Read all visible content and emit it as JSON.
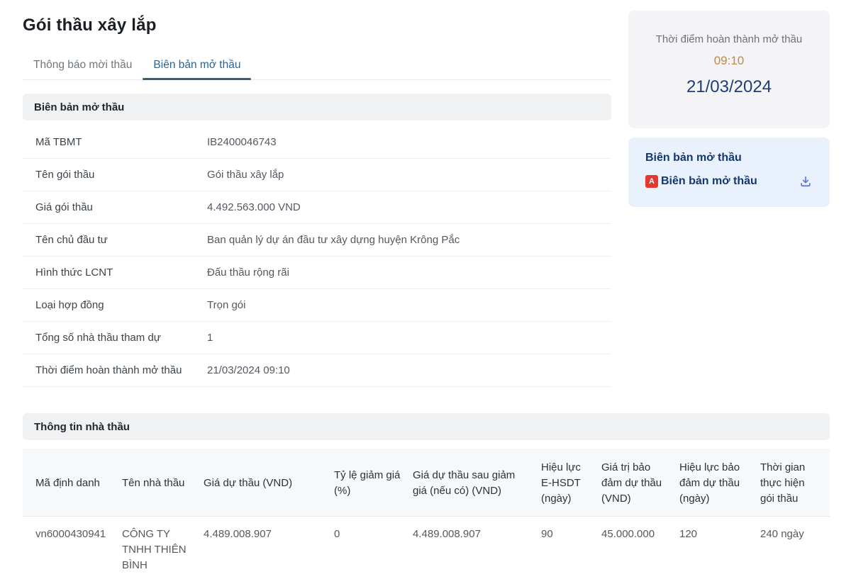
{
  "page": {
    "title": "Gói thầu xây lắp"
  },
  "tabs": [
    {
      "label": "Thông báo mời thầu",
      "active": false
    },
    {
      "label": "Biên bản mở thầu",
      "active": true
    }
  ],
  "sections": {
    "open_record": "Biên bản mở thầu",
    "contractor_info": "Thông tin nhà thầu"
  },
  "details": [
    {
      "label": "Mã TBMT",
      "value": "IB2400046743"
    },
    {
      "label": "Tên gói thầu",
      "value": "Gói thầu xây lắp"
    },
    {
      "label": "Giá gói thầu",
      "value": "4.492.563.000 VND"
    },
    {
      "label": "Tên chủ đầu tư",
      "value": "Ban quản lý dự án đầu tư xây dựng huyện Krông Pắc"
    },
    {
      "label": "Hình thức LCNT",
      "value": "Đấu thầu rộng rãi"
    },
    {
      "label": "Loại hợp đồng",
      "value": "Trọn gói"
    },
    {
      "label": "Tổng số nhà thầu tham dự",
      "value": "1"
    },
    {
      "label": "Thời điểm hoàn thành mở thầu",
      "value": "21/03/2024 09:10"
    }
  ],
  "sidebar": {
    "completion": {
      "label": "Thời điểm hoàn thành mở thầu",
      "time": "09:10",
      "date": "21/03/2024"
    },
    "record": {
      "title": "Biên bản mở thầu",
      "file_label": "Biên bản mở thầu",
      "pdf_icon": "pdf-file-icon",
      "download_icon": "download-icon"
    }
  },
  "table": {
    "columns": [
      "Mã định danh",
      "Tên nhà thầu",
      "Giá dự thầu (VND)",
      "Tỷ lệ giảm giá (%)",
      "Giá dự thầu sau giảm giá (nếu có) (VND)",
      "Hiệu lực E-HSDT (ngày)",
      "Giá trị bảo đảm dự thầu (VND)",
      "Hiệu lực bảo đảm dự thầu (ngày)",
      "Thời gian thực hiện gói thầu"
    ],
    "rows": [
      [
        "vn6000430941",
        "CÔNG TY TNHH THIÊN BÌNH",
        "4.489.008.907",
        "0",
        "4.489.008.907",
        "90",
        "45.000.000",
        "120",
        "240 ngày"
      ]
    ]
  },
  "colors": {
    "tab_active": "#2b6494",
    "tab_underline": "#3e5c70",
    "time_accent": "#bb8a4e",
    "date_navy": "#1c3e74",
    "record_link": "#14386e",
    "download_blue": "#5b74dc",
    "pdf_red": "#e5382f",
    "section_bar_bg": "#eff1f3",
    "card_time_bg": "#f4f4f6",
    "card_record_bg": "#e9f1fc"
  }
}
